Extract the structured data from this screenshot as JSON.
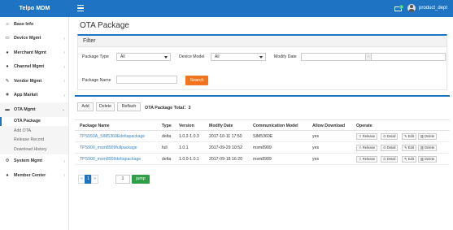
{
  "header": {
    "brand": "Telpo MDM",
    "mail_badge": "3",
    "username": "product_dept",
    "accent": "#1e74c2"
  },
  "sidebar": {
    "items": [
      {
        "label": "Base Info",
        "icon": "home-icon"
      },
      {
        "label": "Device Mgmt",
        "icon": "device-icon"
      },
      {
        "label": "Merchant Mgmt",
        "icon": "user-icon"
      },
      {
        "label": "Channel Mgmt",
        "icon": "users-icon"
      },
      {
        "label": "Vendor Mgmt",
        "icon": "wrench-icon"
      },
      {
        "label": "App Market",
        "icon": "cart-icon"
      },
      {
        "label": "OTA Mgmt",
        "icon": "folder-icon"
      }
    ],
    "ota_sub": [
      "OTA Package",
      "Add OTA",
      "Release Record",
      "Download History"
    ],
    "bottom_items": [
      {
        "label": "System Mgmt",
        "icon": "gear-icon"
      },
      {
        "label": "Member Center",
        "icon": "user-icon"
      }
    ]
  },
  "page": {
    "title": "OTA Package"
  },
  "filter": {
    "heading": "Filter",
    "package_type_label": "Package Type",
    "package_type_value": "All",
    "device_model_label": "Device Model",
    "device_model_value": "All",
    "modify_date_label": "Modify Date",
    "date_separator": "-",
    "package_name_label": "Package Name",
    "search_label": "Search"
  },
  "toolbar": {
    "add": "Add",
    "delete": "Delete",
    "refresh": "Reflash",
    "total_label": "OTA Package Total：3"
  },
  "table": {
    "headers": [
      "Package Name",
      "Type",
      "Version",
      "Modify Date",
      "Communication Model",
      "Allow Download",
      "Operate"
    ],
    "rows": [
      {
        "name": "TPS550A_SIM5360Edeltapackage",
        "type": "delta",
        "version": "1.0.2-1.0.3",
        "date": "2017-10-11 17:50",
        "model": "SIM5360E",
        "allow": "yes"
      },
      {
        "name": "TPS900_msm8909fullpackage",
        "type": "full",
        "version": "1.0.1",
        "date": "2017-09-29 10:52",
        "model": "msm8909",
        "allow": "yes"
      },
      {
        "name": "TPS900_msm8909deltapackage",
        "type": "delta",
        "version": "1.0.0-1.0.1",
        "date": "2017-09-18 16:20",
        "model": "msm8909",
        "allow": "yes"
      }
    ],
    "ops": [
      "Release",
      "Detail",
      "Edit",
      "Delete"
    ]
  },
  "pager": {
    "first": "«",
    "page": "1",
    "last": "»",
    "input_value": "1",
    "jump": "jump"
  }
}
